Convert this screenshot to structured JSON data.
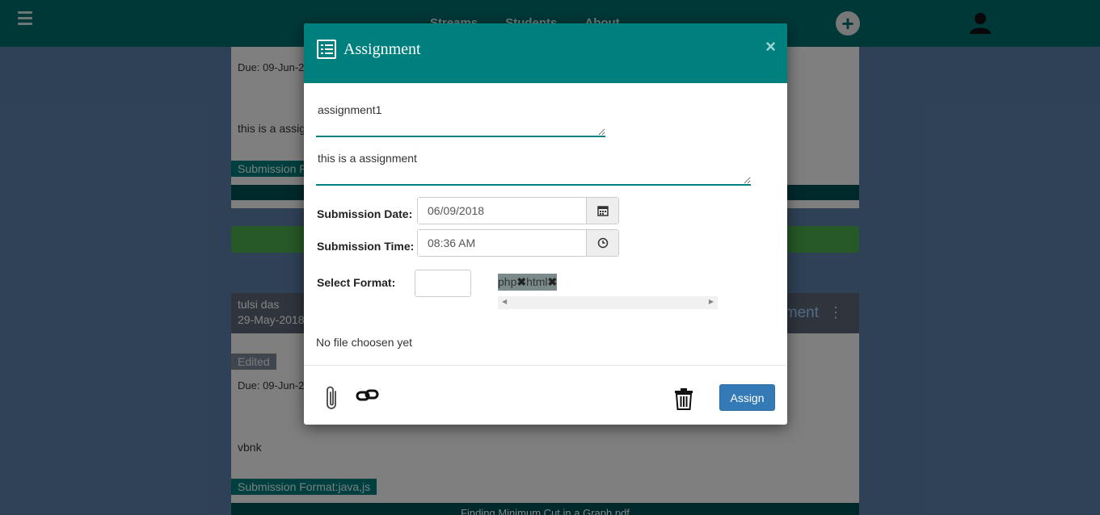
{
  "topbar": {
    "nav": [
      "Streams",
      "Students",
      "About"
    ]
  },
  "feed": {
    "card1": {
      "due": "Due: 09-Jun-2",
      "text": "this is a assig",
      "format": "Submission F"
    },
    "card2": {
      "author": "tulsi das",
      "date": "29-May-2018",
      "title_fragment": "ment",
      "edited": "Edited",
      "due": "Due: 09-Jun-2",
      "text": "vbnk",
      "format": "Submission Format:java,js",
      "file": "Finding Minimum Cut in a Graph.pdf"
    }
  },
  "modal": {
    "title": "Assignment",
    "close": "×",
    "assignment_title": "assignment1",
    "assignment_description": "this is a assignment",
    "submission_date_label": "Submission Date:",
    "submission_date": "06/09/2018",
    "submission_time_label": "Submission Time:",
    "submission_time": "08:36 AM",
    "select_format_label": "Select Format:",
    "formats": [
      "php",
      "html"
    ],
    "no_file": "No file choosen yet",
    "assign_label": "Assign"
  },
  "colors": {
    "header": "#007f7f",
    "topbar": "#006b6b",
    "button": "#337ab7"
  }
}
